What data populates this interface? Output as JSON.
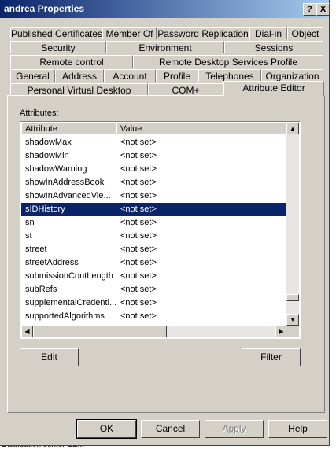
{
  "window": {
    "title": "andrea Properties",
    "help_glyph": "?",
    "close_glyph": "X"
  },
  "tabs": {
    "row1": [
      "Published Certificates",
      "Member Of",
      "Password Replication",
      "Dial-in",
      "Object"
    ],
    "row2": [
      "Security",
      "Environment",
      "Sessions"
    ],
    "row3": [
      "Remote control",
      "Remote Desktop Services Profile"
    ],
    "row4": [
      "General",
      "Address",
      "Account",
      "Profile",
      "Telephones",
      "Organization"
    ],
    "row5": [
      "Personal Virtual Desktop",
      "COM+",
      "Attribute Editor"
    ],
    "active": "Attribute Editor"
  },
  "attributes": {
    "label": "Attributes:",
    "columns": [
      "Attribute",
      "Value"
    ],
    "rows": [
      {
        "name": "shadowMax",
        "value": "<not set>"
      },
      {
        "name": "shadowMin",
        "value": "<not set>"
      },
      {
        "name": "shadowWarning",
        "value": "<not set>"
      },
      {
        "name": "showInAddressBook",
        "value": "<not set>"
      },
      {
        "name": "showInAdvancedVie...",
        "value": "<not set>"
      },
      {
        "name": "sIDHistory",
        "value": "<not set>"
      },
      {
        "name": "sn",
        "value": "<not set>"
      },
      {
        "name": "st",
        "value": "<not set>"
      },
      {
        "name": "street",
        "value": "<not set>"
      },
      {
        "name": "streetAddress",
        "value": "<not set>"
      },
      {
        "name": "submissionContLength",
        "value": "<not set>"
      },
      {
        "name": "subRefs",
        "value": "<not set>"
      },
      {
        "name": "supplementalCredenti...",
        "value": "<not set>"
      },
      {
        "name": "supportedAlgorithms",
        "value": "<not set>"
      }
    ],
    "selected_index": 5
  },
  "buttons": {
    "edit": "Edit",
    "filter": "Filter",
    "ok": "OK",
    "cancel": "Cancel",
    "apply": "Apply",
    "help": "Help"
  },
  "background": {
    "footer_text": "Distribution center BEM"
  }
}
